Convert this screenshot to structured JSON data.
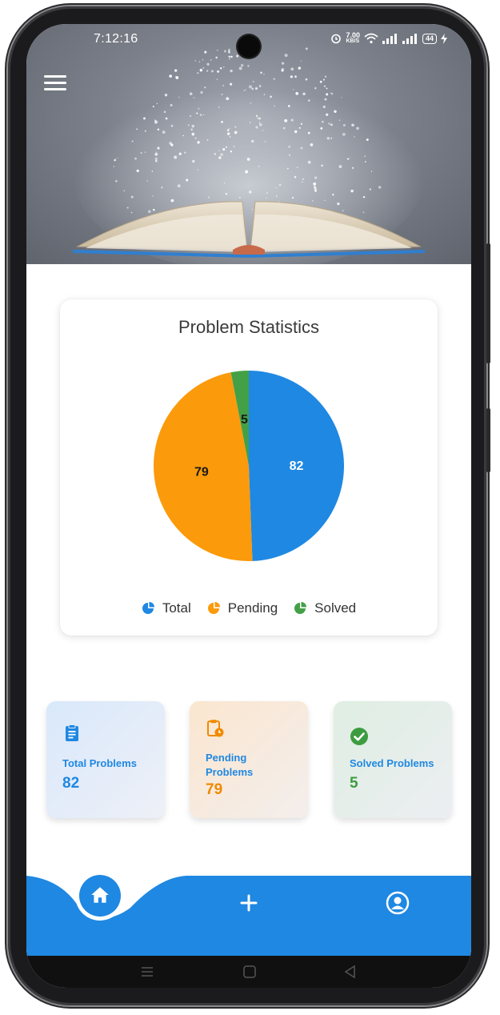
{
  "status_bar": {
    "time": "7:12:16",
    "net_speed": "7.00",
    "net_unit": "KB/S",
    "battery": "44"
  },
  "chart_card": {
    "title": "Problem Statistics"
  },
  "chart_data": {
    "type": "pie",
    "title": "Problem Statistics",
    "slices": [
      {
        "label": "Total",
        "value": 82,
        "color": "#1f88e2",
        "text_color": "#ffffff"
      },
      {
        "label": "Pending",
        "value": 79,
        "color": "#fb9a0b",
        "text_color": "#1a1a1a"
      },
      {
        "label": "Solved",
        "value": 5,
        "color": "#43a047",
        "text_color": "#1a1a1a"
      }
    ],
    "legend": [
      "Total",
      "Pending",
      "Solved"
    ],
    "legend_position": "bottom"
  },
  "stats": [
    {
      "label": "Total Problems",
      "value": "82",
      "icon": "clipboard-list-icon",
      "color": "#1f88e2"
    },
    {
      "label": "Pending Problems",
      "value": "79",
      "icon": "clipboard-clock-icon",
      "color": "#f08a00"
    },
    {
      "label": "Solved Problems",
      "value": "5",
      "icon": "check-circle-icon",
      "color": "#3d9c3f"
    }
  ],
  "colors": {
    "accent": "#1f88e2",
    "pending": "#fb9a0b",
    "solved": "#43a047"
  }
}
